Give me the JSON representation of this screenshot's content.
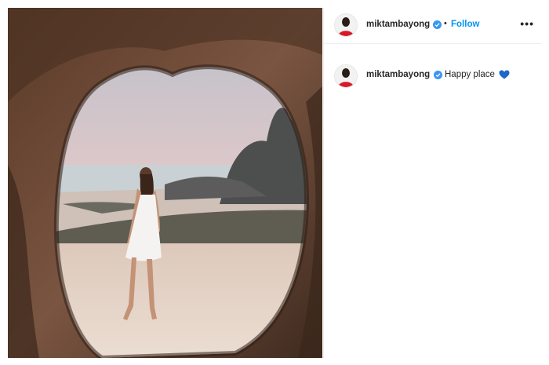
{
  "post": {
    "header": {
      "username": "miktambayong",
      "verified_icon": "verified-badge-icon",
      "separator": "•",
      "follow_label": "Follow",
      "more_label": "•••"
    },
    "caption": {
      "username": "miktambayong",
      "text": "Happy place",
      "emoji_icon": "blue-heart-icon"
    },
    "media": {
      "description_icon": "photo-image"
    }
  },
  "colors": {
    "accent": "#0095f6",
    "verified": "#3897f0",
    "heart": "#1f66c8",
    "text": "#262626",
    "divider": "#efefef"
  }
}
